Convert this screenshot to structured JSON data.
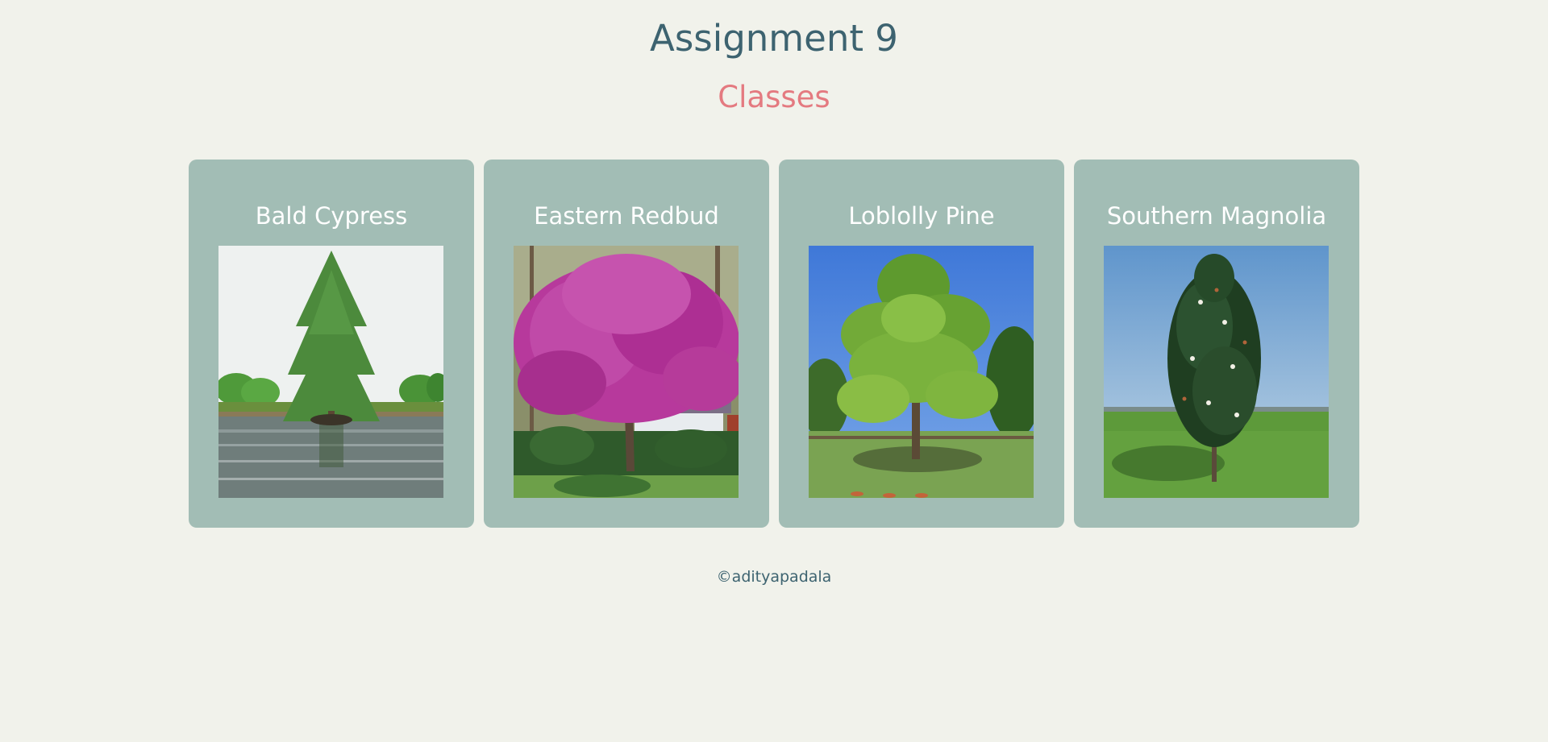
{
  "header": {
    "title": "Assignment 9",
    "subtitle": "Classes"
  },
  "cards": [
    {
      "title": "Bald Cypress",
      "image": "bald-cypress-tree-photo"
    },
    {
      "title": "Eastern Redbud",
      "image": "eastern-redbud-tree-photo"
    },
    {
      "title": "Loblolly Pine",
      "image": "loblolly-pine-tree-photo"
    },
    {
      "title": "Southern Magnolia",
      "image": "southern-magnolia-tree-photo"
    }
  ],
  "footer": {
    "text": "©adityapadala"
  },
  "colors": {
    "background": "#f1f2eb",
    "title": "#3d6370",
    "subtitle": "#e47a80",
    "card": "#a2bdb5"
  }
}
